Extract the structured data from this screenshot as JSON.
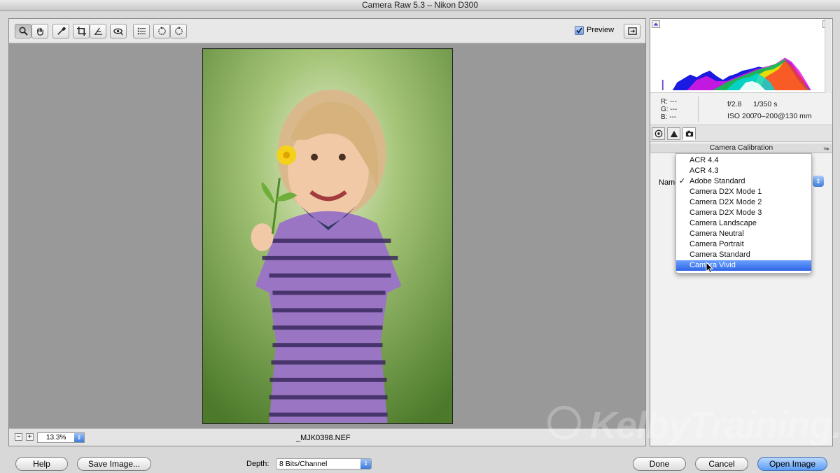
{
  "window": {
    "title": "Camera Raw 5.3  –  Nikon D300"
  },
  "toolbar": {
    "tools": [
      "zoom-tool",
      "hand-tool",
      "white-balance-tool",
      "crop-tool",
      "straighten-tool",
      "red-eye-tool",
      "preferences",
      "rotate-ccw",
      "rotate-cw"
    ],
    "preview_label": "Preview",
    "preview_checked": true
  },
  "status": {
    "zoom_level": "13.3%",
    "filename": "_MJK0398.NEF"
  },
  "readouts": {
    "r": "R:  ---",
    "g": "G:  ---",
    "b": "B:  ---",
    "aperture": "f/2.8",
    "shutter": "1/350 s",
    "iso": "ISO 200",
    "lens": "70–200@130 mm"
  },
  "panel": {
    "header": "Camera Calibration",
    "name_label": "Name"
  },
  "profile_menu": {
    "items": [
      {
        "label": "ACR 4.4",
        "checked": false
      },
      {
        "label": "ACR 4.3",
        "checked": false
      },
      {
        "label": "Adobe Standard",
        "checked": true
      },
      {
        "label": "Camera D2X Mode 1",
        "checked": false
      },
      {
        "label": "Camera D2X Mode 2",
        "checked": false
      },
      {
        "label": "Camera D2X Mode 3",
        "checked": false
      },
      {
        "label": "Camera Landscape",
        "checked": false
      },
      {
        "label": "Camera Neutral",
        "checked": false
      },
      {
        "label": "Camera Portrait",
        "checked": false
      },
      {
        "label": "Camera Standard",
        "checked": false
      },
      {
        "label": "Camera Vivid",
        "checked": false,
        "highlighted": true
      }
    ],
    "checkmark": "✓"
  },
  "footer": {
    "help": "Help",
    "save_image": "Save Image...",
    "depth_label": "Depth:",
    "depth_value": "8 Bits/Channel",
    "done": "Done",
    "cancel": "Cancel",
    "open_image": "Open Image"
  },
  "watermark": "KelbyTraining.com",
  "colors": {
    "accent": "#2f66e6",
    "default_button": "#5b9cf5"
  }
}
